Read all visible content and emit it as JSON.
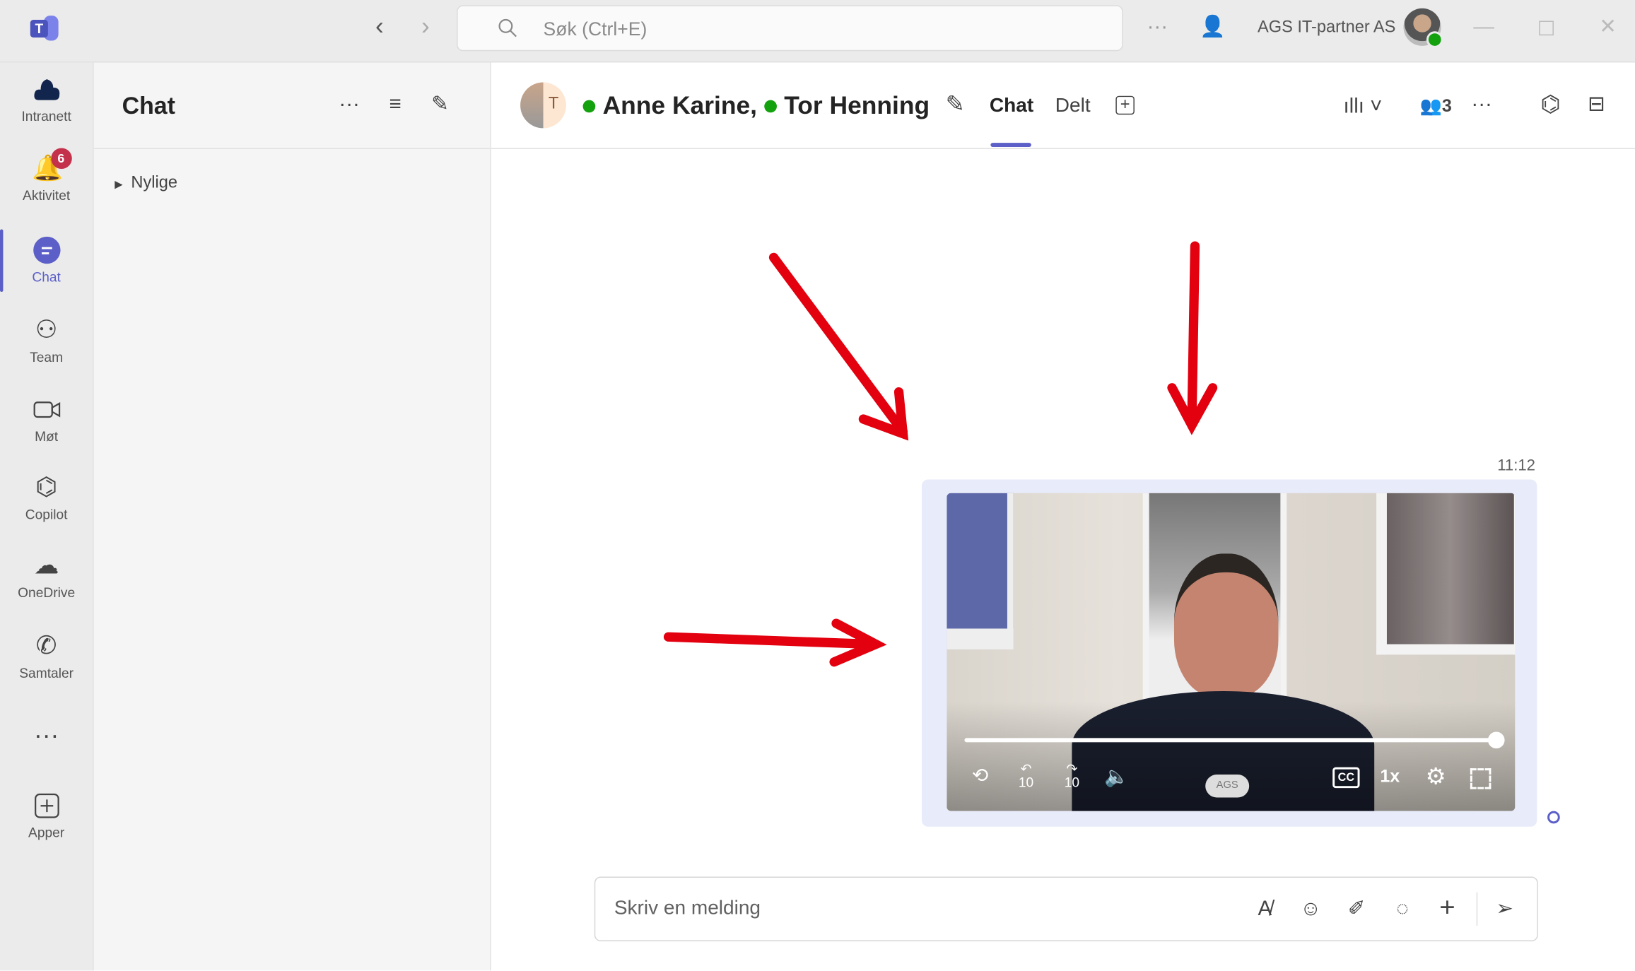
{
  "titlebar": {
    "search_placeholder": "Søk (Ctrl+E)",
    "org_name": "AGS IT-partner AS"
  },
  "rail": {
    "items": [
      {
        "label": "Intranett",
        "icon": "ags-cloud-icon"
      },
      {
        "label": "Aktivitet",
        "icon": "bell-icon",
        "badge": "6"
      },
      {
        "label": "Chat",
        "icon": "chat-icon",
        "active": true
      },
      {
        "label": "Team",
        "icon": "team-icon"
      },
      {
        "label": "Møt",
        "icon": "video-camera-icon"
      },
      {
        "label": "Copilot",
        "icon": "copilot-icon"
      },
      {
        "label": "OneDrive",
        "icon": "cloud-icon"
      },
      {
        "label": "Samtaler",
        "icon": "phone-icon"
      },
      {
        "label": "Apper",
        "icon": "add-app-icon"
      }
    ]
  },
  "chatlist": {
    "title": "Chat",
    "section": "Nylige"
  },
  "header": {
    "avatar_initial": "T",
    "participant1": "Anne Karine,",
    "participant2": "Tor Henning",
    "tabs": [
      "Chat",
      "Delt"
    ],
    "active_tab": "Chat",
    "participant_count": "3"
  },
  "message": {
    "time": "11:12",
    "video": {
      "progress": 1.0,
      "speed": "1x",
      "skip_back": "10",
      "skip_forward": "10",
      "shirt_logo": "AGS"
    }
  },
  "compose": {
    "placeholder": "Skriv en melding"
  },
  "colors": {
    "accent": "#5b5fc7",
    "arrow": "#e3000f",
    "presence": "#13a10e",
    "badge": "#c4314b"
  }
}
